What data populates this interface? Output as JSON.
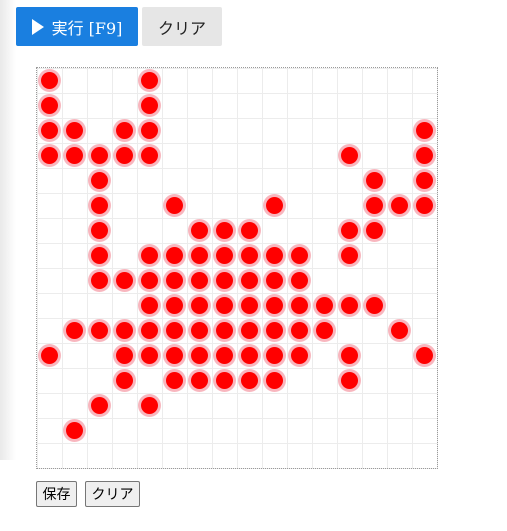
{
  "toolbar": {
    "run_label": "実行 [F9]",
    "clear_label": "クリア",
    "run_color": "#1a7fe0"
  },
  "board": {
    "columns": 16,
    "rows": 16,
    "dot_color": "#ff0000",
    "cells": [
      [
        0,
        0
      ],
      [
        4,
        0
      ],
      [
        0,
        1
      ],
      [
        4,
        1
      ],
      [
        0,
        2
      ],
      [
        1,
        2
      ],
      [
        3,
        2
      ],
      [
        4,
        2
      ],
      [
        15,
        2
      ],
      [
        0,
        3
      ],
      [
        1,
        3
      ],
      [
        2,
        3
      ],
      [
        3,
        3
      ],
      [
        4,
        3
      ],
      [
        12,
        3
      ],
      [
        15,
        3
      ],
      [
        2,
        4
      ],
      [
        13,
        4
      ],
      [
        15,
        4
      ],
      [
        2,
        5
      ],
      [
        5,
        5
      ],
      [
        9,
        5
      ],
      [
        13,
        5
      ],
      [
        14,
        5
      ],
      [
        15,
        5
      ],
      [
        2,
        6
      ],
      [
        6,
        6
      ],
      [
        7,
        6
      ],
      [
        8,
        6
      ],
      [
        12,
        6
      ],
      [
        13,
        6
      ],
      [
        2,
        7
      ],
      [
        4,
        7
      ],
      [
        5,
        7
      ],
      [
        6,
        7
      ],
      [
        7,
        7
      ],
      [
        8,
        7
      ],
      [
        9,
        7
      ],
      [
        10,
        7
      ],
      [
        12,
        7
      ],
      [
        2,
        8
      ],
      [
        3,
        8
      ],
      [
        4,
        8
      ],
      [
        5,
        8
      ],
      [
        6,
        8
      ],
      [
        7,
        8
      ],
      [
        8,
        8
      ],
      [
        9,
        8
      ],
      [
        10,
        8
      ],
      [
        4,
        9
      ],
      [
        5,
        9
      ],
      [
        6,
        9
      ],
      [
        7,
        9
      ],
      [
        8,
        9
      ],
      [
        9,
        9
      ],
      [
        10,
        9
      ],
      [
        11,
        9
      ],
      [
        12,
        9
      ],
      [
        13,
        9
      ],
      [
        1,
        10
      ],
      [
        2,
        10
      ],
      [
        3,
        10
      ],
      [
        4,
        10
      ],
      [
        5,
        10
      ],
      [
        6,
        10
      ],
      [
        7,
        10
      ],
      [
        8,
        10
      ],
      [
        9,
        10
      ],
      [
        10,
        10
      ],
      [
        11,
        10
      ],
      [
        14,
        10
      ],
      [
        0,
        11
      ],
      [
        3,
        11
      ],
      [
        4,
        11
      ],
      [
        5,
        11
      ],
      [
        6,
        11
      ],
      [
        7,
        11
      ],
      [
        8,
        11
      ],
      [
        9,
        11
      ],
      [
        10,
        11
      ],
      [
        12,
        11
      ],
      [
        15,
        11
      ],
      [
        3,
        12
      ],
      [
        5,
        12
      ],
      [
        6,
        12
      ],
      [
        7,
        12
      ],
      [
        8,
        12
      ],
      [
        9,
        12
      ],
      [
        12,
        12
      ],
      [
        2,
        13
      ],
      [
        4,
        13
      ],
      [
        1,
        14
      ]
    ]
  },
  "footer": {
    "save_label": "保存",
    "clear_label": "クリア"
  }
}
